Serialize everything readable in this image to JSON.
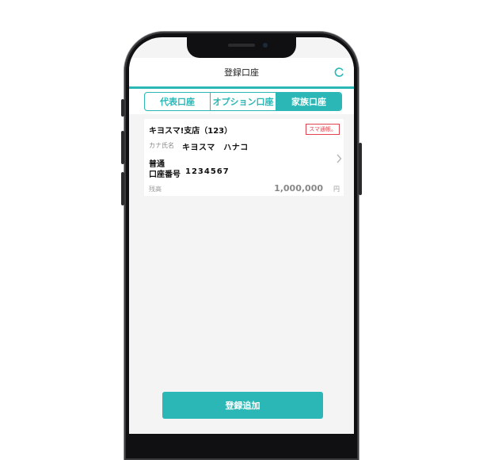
{
  "header": {
    "title": "登録口座"
  },
  "tabs": [
    {
      "label": "代表口座",
      "active": false
    },
    {
      "label": "オプション口座",
      "active": false
    },
    {
      "label": "家族口座",
      "active": true
    }
  ],
  "account": {
    "branch": "キヨスマ!支店（123）",
    "badge": "スマ通帳。",
    "kana_label": "カナ氏名",
    "kana_name": "キヨスマ　ハナコ",
    "type": "普通",
    "number_label": "口座番号",
    "number": "1234567",
    "balance_label": "残高",
    "balance": "1,000,000",
    "balance_unit": "円"
  },
  "footer": {
    "add_button": "登録追加"
  },
  "colors": {
    "accent": "#2ab7b6",
    "badge": "#e0434d"
  },
  "icons": {
    "refresh": "refresh-icon",
    "chevron": "chevron-right-icon"
  }
}
